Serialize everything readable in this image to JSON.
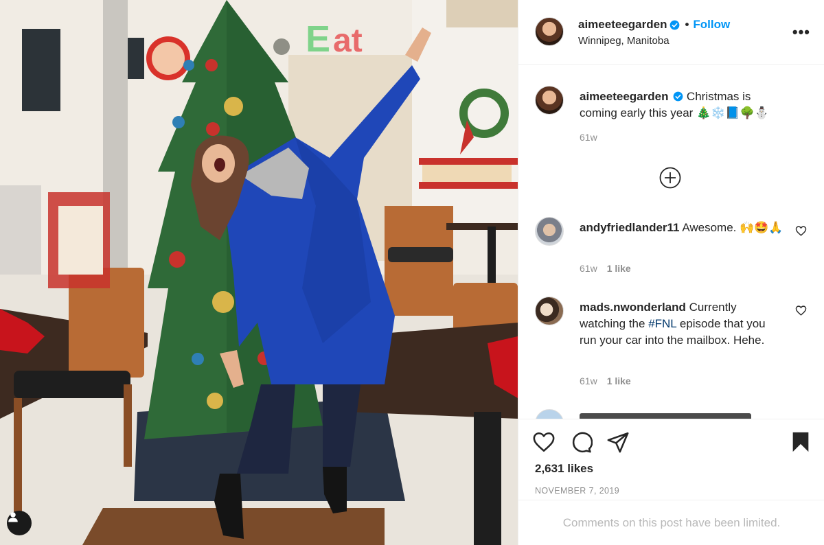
{
  "post": {
    "username": "aimeeteegarden",
    "follow_label": "Follow",
    "separator": "•",
    "location": "Winnipeg, Manitoba",
    "more_label": "•••"
  },
  "caption": {
    "username": "aimeeteegarden",
    "text": "Christmas is coming early this year 🎄❄️📘🌳⛄",
    "time": "61w"
  },
  "comments": [
    {
      "username": "andyfriedlander11",
      "text": "Awesome. 🙌🤩🙏",
      "time": "61w",
      "likes": "1 like"
    },
    {
      "username": "mads.nwonderland",
      "text_before": "Currently watching the ",
      "hashtag": "#FNL",
      "text_after": " episode that you run your car into the mailbox. Hehe.",
      "time": "61w",
      "likes": "1 like"
    }
  ],
  "likes_count": "2,631 likes",
  "date": "NOVEMBER 7, 2019",
  "comments_limited": "Comments on this post have been limited.",
  "colors": {
    "accent": "#0095f6",
    "muted": "#8e8e8e",
    "coat": "#1f47b8"
  }
}
